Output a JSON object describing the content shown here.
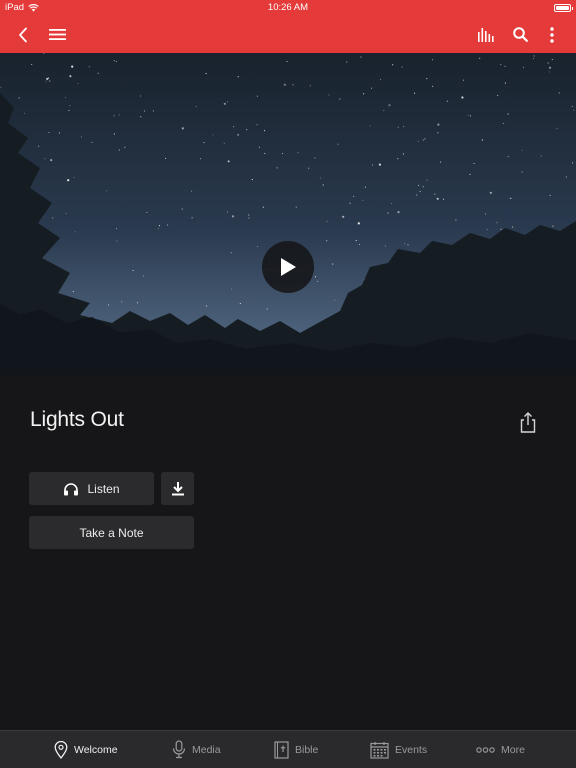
{
  "status_bar": {
    "carrier": "iPad",
    "time": "10:26 AM",
    "battery_level": 1.0
  },
  "navbar": {
    "background": "#e53a3a",
    "icons": [
      "back-icon",
      "menu-icon",
      "audio-levels-icon",
      "search-icon",
      "more-vertical-icon"
    ]
  },
  "media": {
    "title": "Lights Out",
    "hero_icon": "play-icon"
  },
  "actions": {
    "listen_label": "Listen",
    "note_label": "Take a Note"
  },
  "tabbar": {
    "tabs": [
      {
        "label": "Welcome",
        "icon": "location-pin-icon",
        "active": true
      },
      {
        "label": "Media",
        "icon": "microphone-icon",
        "active": false
      },
      {
        "label": "Bible",
        "icon": "bible-icon",
        "active": false
      },
      {
        "label": "Events",
        "icon": "calendar-icon",
        "active": false
      },
      {
        "label": "More",
        "icon": "ellipsis-icon",
        "active": false
      }
    ]
  }
}
